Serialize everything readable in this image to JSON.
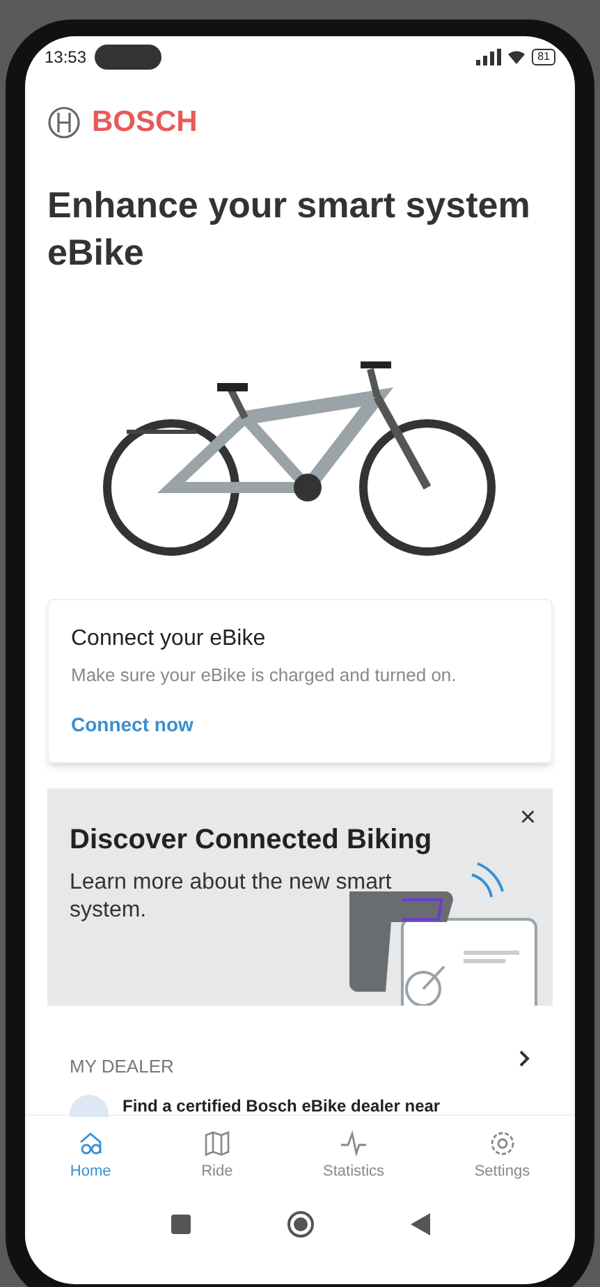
{
  "status_bar": {
    "time": "13:53",
    "battery": "81"
  },
  "header": {
    "brand": "BOSCH"
  },
  "title": {
    "text": "Enhance your smart system eBike"
  },
  "connect_card": {
    "title": "Connect your eBike",
    "text": "Make sure your eBike is charged and turned on.",
    "link": "Connect now"
  },
  "discover_card": {
    "title": "Discover Connected Biking",
    "text": "Learn more about the new smart system.",
    "close": "×"
  },
  "dealer": {
    "heading": "MY DEALER",
    "text": "Find a certified Bosch eBike dealer near"
  },
  "bottom_nav": [
    {
      "label": "Home",
      "kind": "home",
      "selected": true
    },
    {
      "label": "Ride",
      "kind": "map",
      "selected": false
    },
    {
      "label": "Statistics",
      "kind": "pulse",
      "selected": false
    },
    {
      "label": "Settings",
      "kind": "gear",
      "selected": false
    }
  ]
}
